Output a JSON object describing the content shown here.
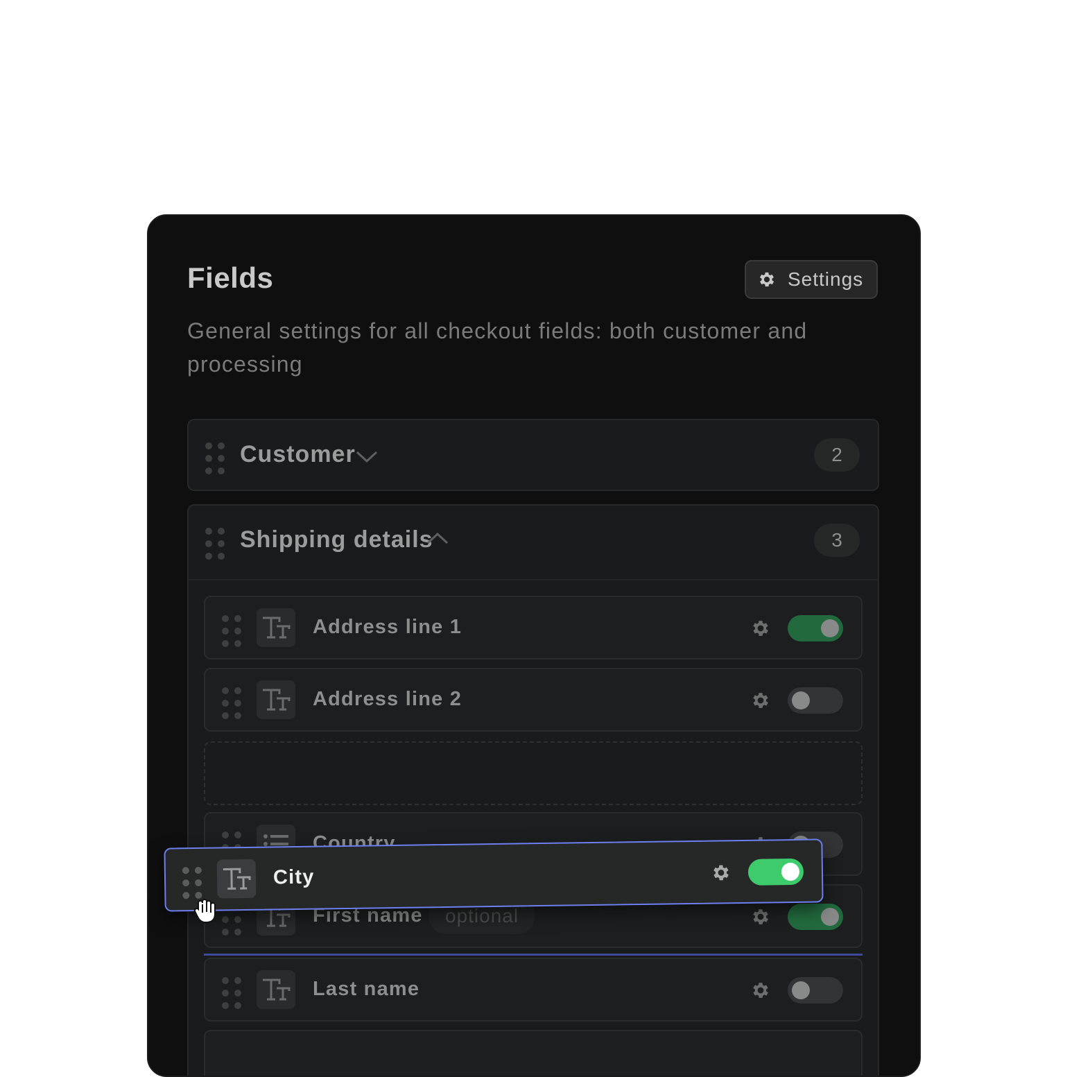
{
  "panel": {
    "title": "Fields",
    "settings_label": "Settings",
    "subtitle": "General settings for all checkout fields: both customer and processing"
  },
  "groups": [
    {
      "label": "Customer",
      "count": "2",
      "expanded": false
    },
    {
      "label": "Shipping details",
      "count": "3",
      "expanded": true,
      "fields": [
        {
          "label": "Address line 1",
          "icon": "text-type-icon",
          "enabled": true
        },
        {
          "label": "Address line 2",
          "icon": "text-type-icon",
          "enabled": false
        },
        {
          "label": "Country",
          "icon": "list-icon",
          "enabled": false
        },
        {
          "label": "First name",
          "badge": "optional",
          "icon": "text-type-icon",
          "enabled": true
        },
        {
          "label": "Last name",
          "icon": "text-type-icon",
          "enabled": false
        }
      ]
    }
  ],
  "dragging": {
    "label": "City",
    "icon": "text-type-icon",
    "enabled": true
  },
  "colors": {
    "panel_bg": "#0f0f0f",
    "toggle_on": "#226a3e",
    "toggle_on_active": "#3ecb6c",
    "drag_outline": "#6e7ff0"
  }
}
